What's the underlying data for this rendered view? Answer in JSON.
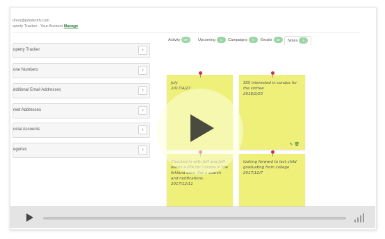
{
  "account": {
    "email": "ohnn@johnbroth.com",
    "subtitle": "operty Tracker - Your Account",
    "manage_label": "Manage"
  },
  "sidebar": {
    "items": [
      {
        "label": "operty Tracker"
      },
      {
        "label": "one Numbers"
      },
      {
        "label": "dditional Email Addresses"
      },
      {
        "label": "reet Addresses"
      },
      {
        "label": "ocial Accounts"
      },
      {
        "label": "egories"
      }
    ],
    "chevron": "›"
  },
  "tabs": [
    {
      "label": "Activity",
      "count": "99+"
    },
    {
      "label": "Upcoming",
      "count": "1"
    },
    {
      "label": "Campaigns",
      "count": "0"
    },
    {
      "label": "Emails",
      "count": "48"
    },
    {
      "label": "Notes",
      "count": "6"
    }
  ],
  "notes": [
    {
      "text": "July",
      "date": "2017/4/27"
    },
    {
      "text": "SSS interested in condos for the sinfree",
      "date": "2018/2/23"
    },
    {
      "text": "Checked in with Jeff and Jeff wants a PTA for Condos in the lirkland area. Set a search and notifications.",
      "date": "2017/12/11"
    },
    {
      "text": "looking forward to last child graduating from college",
      "date": "2017/12/7"
    }
  ],
  "note_action_icons": [
    "pencil-icon",
    "trash-icon"
  ],
  "player": {
    "progress": 0
  }
}
